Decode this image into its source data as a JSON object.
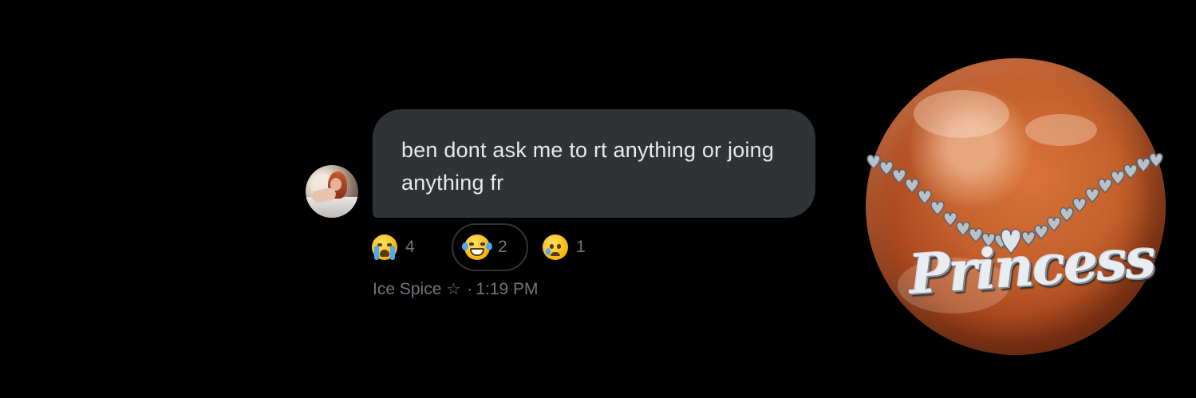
{
  "message": {
    "text": "ben dont ask me to rt anything or joing anything fr"
  },
  "reactions": [
    {
      "icon": "loudly-crying-emoji",
      "count": "4"
    },
    {
      "icon": "tears-of-joy-emoji",
      "count": "2"
    },
    {
      "icon": "crying-face-emoji",
      "count": "1"
    }
  ],
  "meta": {
    "sender": "Ice Spice",
    "star": "☆",
    "separator": "·",
    "time": "1:19 PM"
  },
  "decoration": {
    "pendant_text": "Princess"
  },
  "colors": {
    "background": "#000000",
    "bubble": "#2f3336",
    "text": "#e7e9ea",
    "muted": "#71767b"
  }
}
